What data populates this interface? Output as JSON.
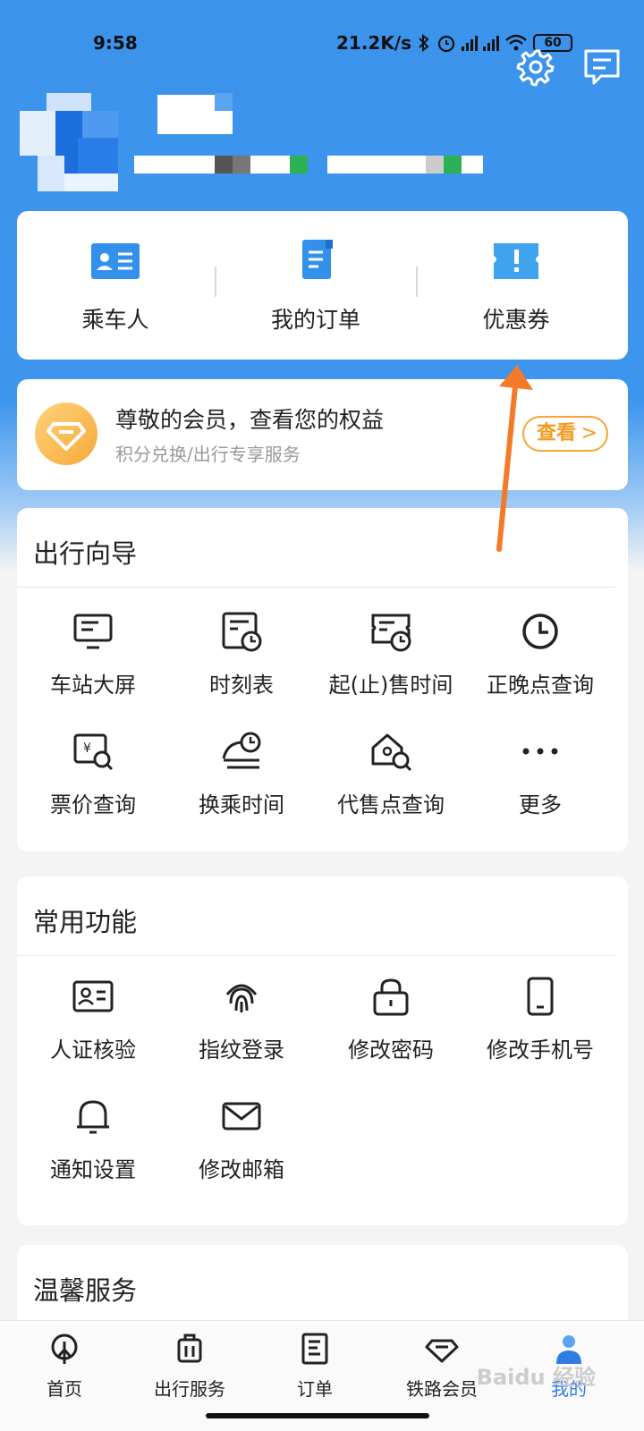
{
  "status_bar": {
    "time": "9:58",
    "network_speed": "21.2K/s",
    "battery": "60"
  },
  "header": {
    "settings_icon": "gear-icon",
    "message_icon": "message-icon"
  },
  "quick_actions": [
    {
      "label": "乘车人",
      "icon": "passenger-card-icon"
    },
    {
      "label": "我的订单",
      "icon": "order-doc-icon"
    },
    {
      "label": "优惠券",
      "icon": "coupon-icon"
    }
  ],
  "member_banner": {
    "title": "尊敬的会员，查看您的权益",
    "subtitle": "积分兑换/出行专享服务",
    "button": "查看",
    "button_chevron": ">"
  },
  "travel_guide": {
    "title": "出行向导",
    "items": [
      {
        "label": "车站大屏",
        "icon": "station-screen-icon"
      },
      {
        "label": "时刻表",
        "icon": "timetable-icon"
      },
      {
        "label": "起(止)售时间",
        "icon": "sale-time-icon"
      },
      {
        "label": "正晚点查询",
        "icon": "clock-icon"
      },
      {
        "label": "票价查询",
        "icon": "fare-search-icon"
      },
      {
        "label": "换乘时间",
        "icon": "transfer-time-icon"
      },
      {
        "label": "代售点查询",
        "icon": "agency-search-icon"
      },
      {
        "label": "更多",
        "icon": "more-icon"
      }
    ]
  },
  "common_functions": {
    "title": "常用功能",
    "items": [
      {
        "label": "人证核验",
        "icon": "id-verify-icon"
      },
      {
        "label": "指纹登录",
        "icon": "fingerprint-icon"
      },
      {
        "label": "修改密码",
        "icon": "lock-icon"
      },
      {
        "label": "修改手机号",
        "icon": "phone-icon"
      },
      {
        "label": "通知设置",
        "icon": "bell-icon"
      },
      {
        "label": "修改邮箱",
        "icon": "mail-icon"
      }
    ]
  },
  "warm_service": {
    "title": "温馨服务"
  },
  "tabbar": [
    {
      "label": "首页",
      "icon": "train-home-icon"
    },
    {
      "label": "出行服务",
      "icon": "luggage-icon"
    },
    {
      "label": "订单",
      "icon": "order-icon"
    },
    {
      "label": "铁路会员",
      "icon": "diamond-icon"
    },
    {
      "label": "我的",
      "icon": "user-icon",
      "active": true
    }
  ],
  "colors": {
    "header_blue": "#3b93ec",
    "accent_blue": "#2f7de1",
    "member_orange": "#f7a534",
    "annotation_arrow": "#f47a2a"
  },
  "watermark": "Baidu 经验"
}
